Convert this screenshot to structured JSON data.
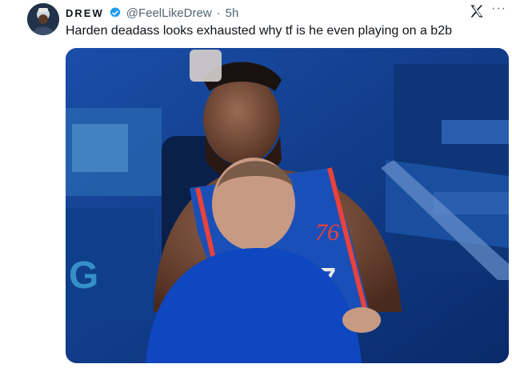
{
  "tweet": {
    "display_name": "DREW",
    "handle": "@FeelLikeDrew",
    "separator": "·",
    "time": "5h",
    "text": "Harden deadass looks exhausted why tf is he even playing on a b2b",
    "more_label": "···",
    "media": {
      "description_icon": "photo-media",
      "jersey_number": "7",
      "jersey_wordmark": "76"
    }
  },
  "colors": {
    "verified": "#1d9bf0",
    "text": "#0f1419",
    "muted": "#536471",
    "arena_blue": "#0c3a8c",
    "jersey_red": "#e8423b"
  },
  "icons": {
    "verified": "verified-badge-icon",
    "logo": "x-logo-icon",
    "more": "more-options-icon"
  }
}
